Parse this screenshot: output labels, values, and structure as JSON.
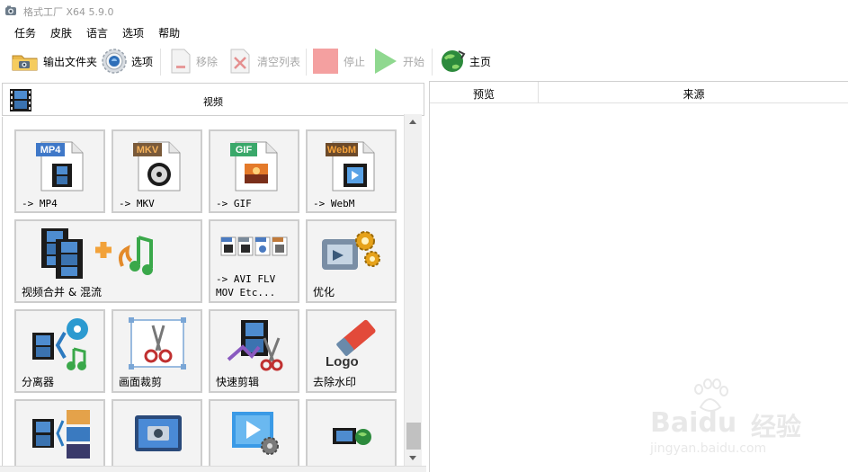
{
  "window": {
    "title": "格式工厂 X64 5.9.0"
  },
  "menu": {
    "items": [
      "任务",
      "皮肤",
      "语言",
      "选项",
      "帮助"
    ]
  },
  "toolbar": {
    "output_folder": "输出文件夹",
    "options": "选项",
    "remove": "移除",
    "clear_list": "清空列表",
    "stop": "停止",
    "start": "开始",
    "home": "主页"
  },
  "category": {
    "title": "视频"
  },
  "tiles": {
    "mp4": {
      "badge": "MP4",
      "label": "-> MP4"
    },
    "mkv": {
      "badge": "MKV",
      "label": "-> MKV"
    },
    "gif": {
      "badge": "GIF",
      "label": "-> GIF"
    },
    "webm": {
      "badge": "WebM",
      "label": "-> WebM"
    },
    "merge": {
      "label": "视频合并 & 混流"
    },
    "avi": {
      "label_line1": "-> AVI FLV",
      "label_line2": "MOV Etc..."
    },
    "optimize": {
      "label": "优化"
    },
    "splitter": {
      "label": "分离器"
    },
    "crop": {
      "label": "画面裁剪"
    },
    "quick_cut": {
      "label": "快速剪辑"
    },
    "watermark_remove": {
      "label": "去除水印",
      "logo_text": "Logo"
    }
  },
  "preview_table": {
    "col_preview": "预览",
    "col_source": "来源"
  },
  "watermark": {
    "brand": "Baidu",
    "brand_cn": "经验",
    "url": "jingyan.baidu.com"
  },
  "colors": {
    "mp4_badge": "#3f78c8",
    "mkv_badge": "#7a5a3a",
    "gif_badge": "#3aa86a",
    "webm_badge": "#d27a1c",
    "stop_red": "#f4a0a0",
    "start_green": "#8fd88f",
    "tile_bg": "#f3f3f3",
    "tile_border": "#cdcdcd"
  }
}
